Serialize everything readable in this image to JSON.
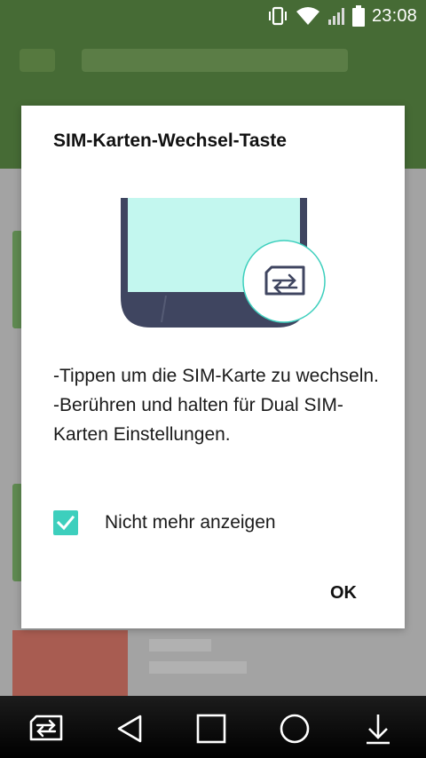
{
  "status_bar": {
    "time": "23:08",
    "icons": [
      "vibrate-icon",
      "wifi-icon",
      "signal-icon",
      "battery-icon"
    ]
  },
  "dialog": {
    "title": "SIM-Karten-Wechsel-Taste",
    "illustration": [
      "phone-illustration",
      "sim-switch-icon"
    ],
    "message_line1": "-Tippen um die SIM-Karte zu wechseln.",
    "message_line2": "-Berühren und halten für Dual SIM-Karten Einstellungen.",
    "checkbox_label": "Nicht mehr anzeigen",
    "checkbox_checked": true,
    "ok_label": "OK",
    "accent_color": "#3dcfbd"
  },
  "nav_bar": {
    "buttons": [
      "sim-switch-icon",
      "back-icon",
      "recents-icon",
      "home-icon",
      "notifications-down-icon"
    ]
  }
}
